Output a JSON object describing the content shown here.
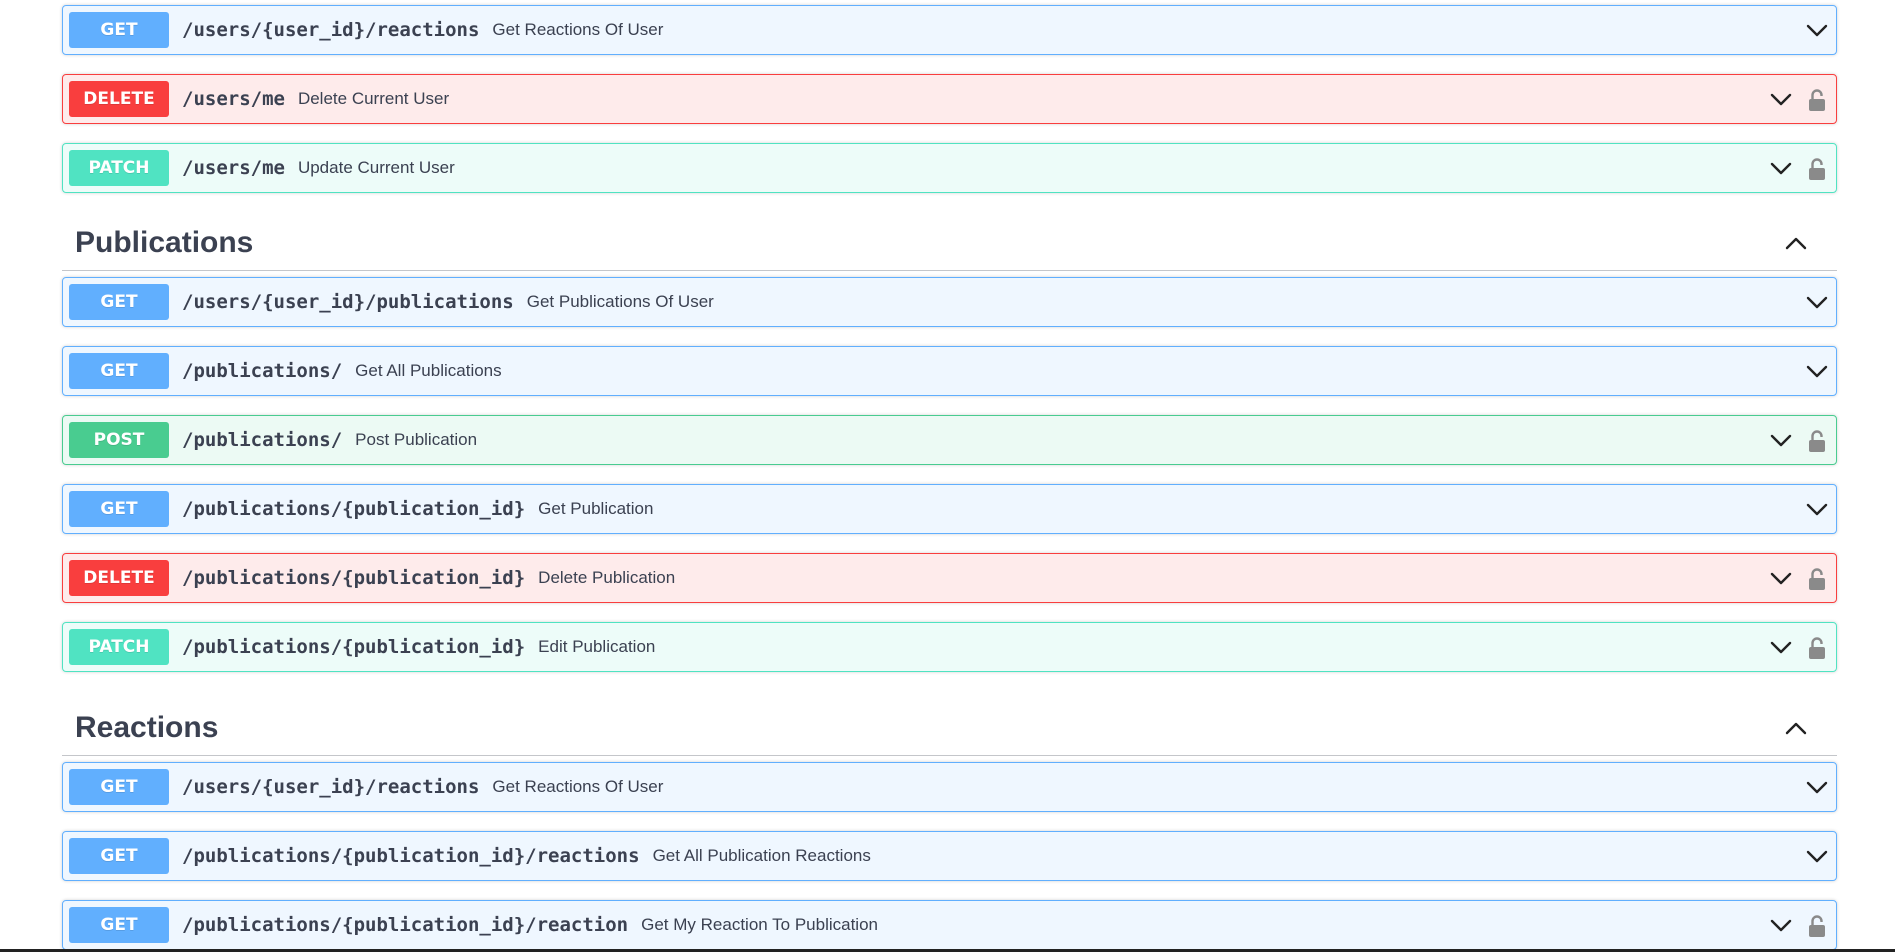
{
  "groups": [
    {
      "title": "",
      "ops": [
        {
          "method": "GET",
          "path": "/users/{user_id}/reactions",
          "summary": "Get Reactions Of User",
          "locked": false
        },
        {
          "method": "DELETE",
          "path": "/users/me",
          "summary": "Delete Current User",
          "locked": true
        },
        {
          "method": "PATCH",
          "path": "/users/me",
          "summary": "Update Current User",
          "locked": true
        }
      ]
    },
    {
      "title": "Publications",
      "ops": [
        {
          "method": "GET",
          "path": "/users/{user_id}/publications",
          "summary": "Get Publications Of User",
          "locked": false
        },
        {
          "method": "GET",
          "path": "/publications/",
          "summary": "Get All Publications",
          "locked": false
        },
        {
          "method": "POST",
          "path": "/publications/",
          "summary": "Post Publication",
          "locked": true
        },
        {
          "method": "GET",
          "path": "/publications/{publication_id}",
          "summary": "Get Publication",
          "locked": false
        },
        {
          "method": "DELETE",
          "path": "/publications/{publication_id}",
          "summary": "Delete Publication",
          "locked": true
        },
        {
          "method": "PATCH",
          "path": "/publications/{publication_id}",
          "summary": "Edit Publication",
          "locked": true
        }
      ]
    },
    {
      "title": "Reactions",
      "ops": [
        {
          "method": "GET",
          "path": "/users/{user_id}/reactions",
          "summary": "Get Reactions Of User",
          "locked": false
        },
        {
          "method": "GET",
          "path": "/publications/{publication_id}/reactions",
          "summary": "Get All Publication Reactions",
          "locked": false
        },
        {
          "method": "GET",
          "path": "/publications/{publication_id}/reaction",
          "summary": "Get My Reaction To Publication",
          "locked": true
        }
      ]
    }
  ],
  "colors": {
    "get": "#61affe",
    "delete": "#f93e3e",
    "patch": "#50e3c2",
    "post": "#49cc90",
    "text": "#3b4151"
  },
  "icons": {
    "expand": "chevron-down-icon",
    "collapse": "chevron-up-icon",
    "auth": "lock-icon"
  }
}
